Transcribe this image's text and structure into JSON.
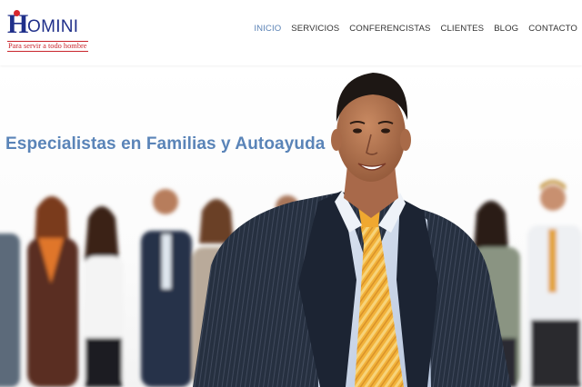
{
  "site": {
    "logo": {
      "initial": "H",
      "rest": "OMINI",
      "tagline": "Para servir a todo hombre"
    }
  },
  "nav": {
    "items": [
      {
        "label": "INICIO",
        "active": true
      },
      {
        "label": "SERVICIOS",
        "active": false
      },
      {
        "label": "CONFERENCISTAS",
        "active": false
      },
      {
        "label": "CLIENTES",
        "active": false
      },
      {
        "label": "BLOG",
        "active": false
      },
      {
        "label": "CONTACTO",
        "active": false
      }
    ]
  },
  "hero": {
    "title": "Especialistas en Familias y Autoayuda"
  },
  "colors": {
    "brand_blue": "#1f2f8a",
    "brand_red": "#c9252c",
    "nav_active": "#5b83b6",
    "nav_text": "#333333",
    "hero_title": "#5a84b8"
  }
}
